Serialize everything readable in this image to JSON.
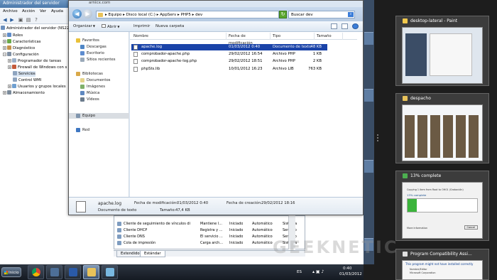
{
  "server_manager": {
    "title": "Administrador del servidor",
    "menu": [
      "Archivo",
      "Acción",
      "Ver",
      "Ayuda"
    ],
    "tree": [
      {
        "label": "Administrador del servidor (NS228)",
        "level": 0
      },
      {
        "label": "Roles",
        "level": 1
      },
      {
        "label": "Características",
        "level": 1
      },
      {
        "label": "Diagnóstico",
        "level": 1
      },
      {
        "label": "Configuración",
        "level": 1
      },
      {
        "label": "Programador de tareas",
        "level": 2
      },
      {
        "label": "Firewall de Windows con s",
        "level": 2
      },
      {
        "label": "Servicios",
        "level": 2
      },
      {
        "label": "Control WMI",
        "level": 2
      },
      {
        "label": "Usuarios y grupos locales",
        "level": 2
      },
      {
        "label": "Almacenamiento",
        "level": 1
      }
    ],
    "services": [
      {
        "name": "Cliente de seguimiento de vínculos distri...",
        "desc": "Mantiene l...",
        "state": "Iniciado",
        "start": "Automático",
        "logon": "Sistema"
      },
      {
        "name": "Cliente DHCP",
        "desc": "Registra y ...",
        "state": "Iniciado",
        "start": "Automático",
        "logon": "Servicio"
      },
      {
        "name": "Cliente DNS",
        "desc": "El servicio ...",
        "state": "Iniciado",
        "start": "Automático",
        "logon": "Servicio"
      },
      {
        "name": "Cola de impresión",
        "desc": "Carga arch...",
        "state": "Iniciado",
        "start": "Automático",
        "logon": "Sistema"
      }
    ],
    "tabs": [
      "Extendido",
      "Estándar"
    ]
  },
  "explorer": {
    "title_fragment": "arnicx.com",
    "address": "▸ Equipo ▸ Disco local (C:) ▸ AppServ ▸ PHP5 ▸ dev",
    "search_placeholder": "Buscar dev",
    "toolbar": {
      "organize": "Organizar",
      "open": "Abrir",
      "print": "Imprimir",
      "new_folder": "Nueva carpeta"
    },
    "nav": [
      {
        "label": "Favoritos",
        "indent": 0
      },
      {
        "label": "Descargas",
        "indent": 1
      },
      {
        "label": "Escritorio",
        "indent": 1
      },
      {
        "label": "Sitios recientes",
        "indent": 1
      },
      {
        "label": "Bibliotecas",
        "indent": 0
      },
      {
        "label": "Documentos",
        "indent": 1
      },
      {
        "label": "Imágenes",
        "indent": 1
      },
      {
        "label": "Música",
        "indent": 1
      },
      {
        "label": "Vídeos",
        "indent": 1
      },
      {
        "label": "Equipo",
        "indent": 0
      },
      {
        "label": "Red",
        "indent": 0
      }
    ],
    "columns": [
      "Nombre",
      "Fecha de modificación",
      "Tipo",
      "Tamaño"
    ],
    "files": [
      {
        "name": "apache.log",
        "date": "01/03/2012 0:40",
        "type": "Documento de texto",
        "size": "48 KB"
      },
      {
        "name": "comprobador-apache.php",
        "date": "29/02/2012 16:54",
        "type": "Archivo PHP",
        "size": "1 KB"
      },
      {
        "name": "comprobador-apache-log.php",
        "date": "29/02/2012 18:51",
        "type": "Archivo PHP",
        "size": "2 KB"
      },
      {
        "name": "phpSts.lib",
        "date": "10/01/2012 16:23",
        "type": "Archivo LIB",
        "size": "763 KB"
      }
    ],
    "details": {
      "name": "apache.log",
      "type": "Documento de texto",
      "modified_label": "Fecha de modificación:",
      "modified": "01/03/2012 0:40",
      "created_label": "Fecha de creación:",
      "created": "29/02/2012 18:16",
      "size_label": "Tamaño:",
      "size": "47,4 KB"
    }
  },
  "thumbnails": [
    {
      "title": "desktop-lateral - Paint",
      "icon_color": "#f2c94c"
    },
    {
      "title": "despacho",
      "icon_color": "#e8c25a"
    },
    {
      "title": "13% complete",
      "icon_color": "#4caf50"
    },
    {
      "title": "Program Compatibility Assi...",
      "icon_color": "#e0e0e0"
    }
  ],
  "progress_thumb": {
    "line1": "Copying 1 item from Root to OH01 (Grabación)",
    "line2": "13% complete",
    "progress": 0.13,
    "more": "More information",
    "cancel": "Cancel"
  },
  "compat_thumb": {
    "line1": "This program might not have installed correctly",
    "line2": "Nombre/Editor",
    "line3": "Microsoft Corporation"
  },
  "taskbar": {
    "start": "Inicio",
    "lang": "ES",
    "time": "0:40",
    "date": "01/03/2012"
  },
  "watermark": "GEEKNETIC"
}
